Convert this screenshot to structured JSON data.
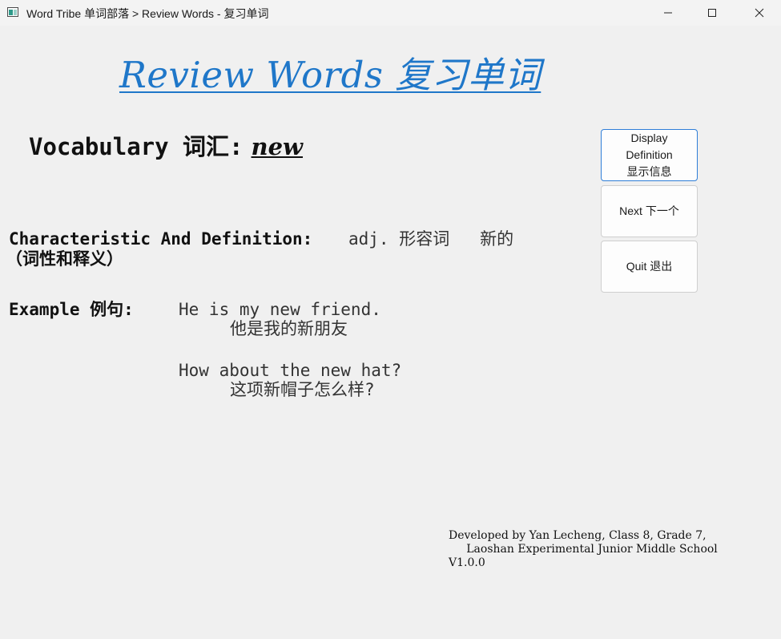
{
  "window": {
    "title": "Word Tribe 单词部落 > Review Words - 复习单词"
  },
  "page": {
    "heading": "Review Words 复习单词"
  },
  "vocabulary": {
    "label": "Vocabulary 词汇:",
    "word": "new"
  },
  "definition": {
    "label": "Characteristic And Definition:",
    "label_cn": "（词性和释义）",
    "value": "adj. 形容词   新的"
  },
  "examples": {
    "label": "Example 例句:",
    "items": [
      {
        "en": "He is my new friend.",
        "cn": "他是我的新朋友"
      },
      {
        "en": "How about the new hat?",
        "cn": "这项新帽子怎么样?"
      }
    ]
  },
  "buttons": {
    "display_line1": "Display",
    "display_line2": "Definition",
    "display_line3": "显示信息",
    "next": "Next 下一个",
    "quit": "Quit 退出"
  },
  "credits": {
    "line1": "Developed by Yan Lecheng, Class 8, Grade 7,",
    "line2": "     Laoshan Experimental Junior Middle School",
    "line3": "V1.0.0"
  },
  "colors": {
    "heading": "#1f77c9",
    "focus_border": "#2f7ed8",
    "background": "#f0f0f0"
  }
}
